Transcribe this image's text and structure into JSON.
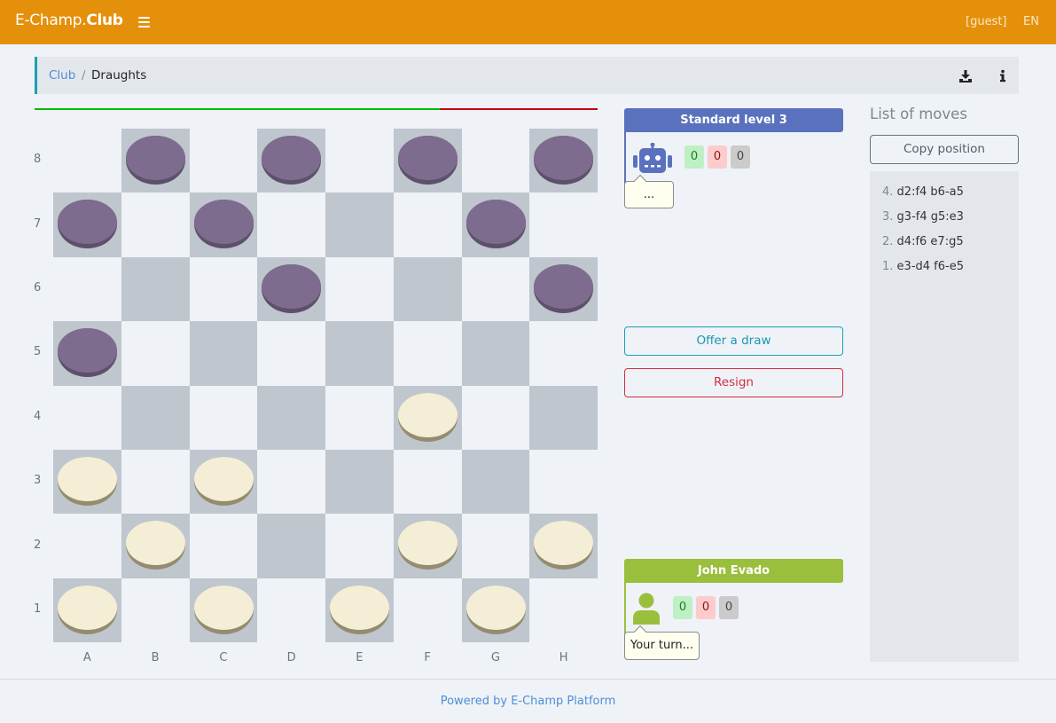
{
  "header": {
    "brand_prefix": "E-Champ.",
    "brand_suffix": "Club",
    "menu_icon": "hamburger-icon",
    "user_label": "[guest]",
    "language_label": "EN"
  },
  "breadcrumb": {
    "items": [
      "Club",
      "Draughts"
    ],
    "separator": "/",
    "actions": [
      {
        "icon": "download-icon",
        "label": "Download"
      },
      {
        "icon": "info-icon",
        "label": "Info"
      }
    ]
  },
  "balance_bar": {
    "green_fraction": 0.72,
    "green_color": "#00bb00",
    "red_color": "#c50010"
  },
  "board": {
    "files": [
      "A",
      "B",
      "C",
      "D",
      "E",
      "F",
      "G",
      "H"
    ],
    "ranks": [
      "8",
      "7",
      "6",
      "5",
      "4",
      "3",
      "2",
      "1"
    ],
    "dark_color": "#bfc6ce",
    "light_color": "#eff2f7",
    "pieces": [
      {
        "square": "b8",
        "color": "black"
      },
      {
        "square": "d8",
        "color": "black"
      },
      {
        "square": "f8",
        "color": "black"
      },
      {
        "square": "h8",
        "color": "black"
      },
      {
        "square": "a7",
        "color": "black"
      },
      {
        "square": "c7",
        "color": "black"
      },
      {
        "square": "g7",
        "color": "black"
      },
      {
        "square": "d6",
        "color": "black"
      },
      {
        "square": "h6",
        "color": "black"
      },
      {
        "square": "a5",
        "color": "black"
      },
      {
        "square": "f4",
        "color": "white"
      },
      {
        "square": "a3",
        "color": "white"
      },
      {
        "square": "c3",
        "color": "white"
      },
      {
        "square": "b2",
        "color": "white"
      },
      {
        "square": "f2",
        "color": "white"
      },
      {
        "square": "h2",
        "color": "white"
      },
      {
        "square": "a1",
        "color": "white"
      },
      {
        "square": "c1",
        "color": "white"
      },
      {
        "square": "e1",
        "color": "white"
      },
      {
        "square": "g1",
        "color": "white"
      }
    ]
  },
  "opponent": {
    "name": "Standard level 3",
    "color": "#5a72bd",
    "avatar_icon": "robot-icon",
    "scores": {
      "wins": "0",
      "losses": "0",
      "draws": "0"
    },
    "status": "..."
  },
  "player": {
    "name": "John Evado",
    "color": "#9abf3d",
    "avatar_icon": "user-icon",
    "scores": {
      "wins": "0",
      "losses": "0",
      "draws": "0"
    },
    "status": "Your turn..."
  },
  "actions": {
    "offer_draw": "Offer a draw",
    "resign": "Resign"
  },
  "moves": {
    "title": "List of moves",
    "copy_button": "Copy position",
    "items": [
      {
        "num": "4.",
        "text": "d2:f4 b6-a5"
      },
      {
        "num": "3.",
        "text": "g3-f4 g5:e3"
      },
      {
        "num": "2.",
        "text": "d4:f6 e7:g5"
      },
      {
        "num": "1.",
        "text": "e3-d4 f6-e5"
      }
    ]
  },
  "footer": {
    "link_text": "Powered by E-Champ Platform"
  }
}
